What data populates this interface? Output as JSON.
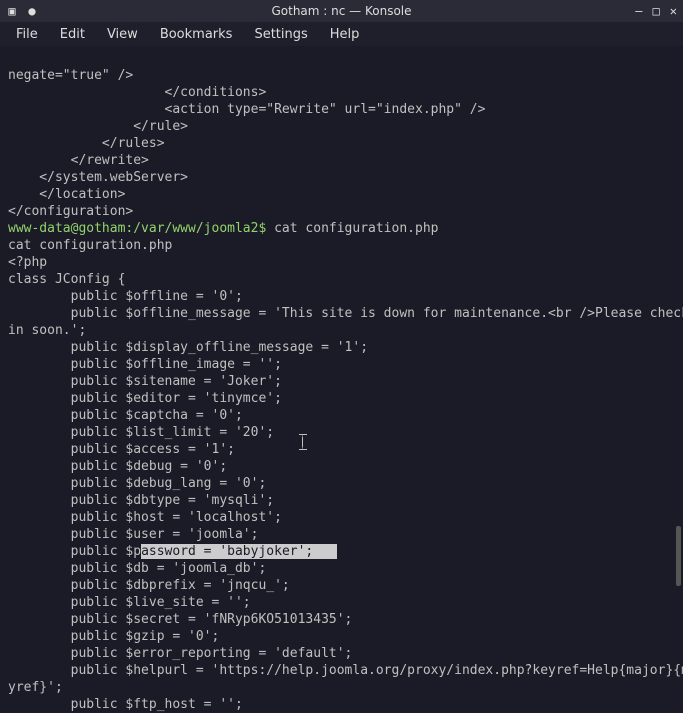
{
  "window": {
    "title": "Gotham : nc — Konsole"
  },
  "menu": {
    "file": "File",
    "edit": "Edit",
    "view": "View",
    "bookmarks": "Bookmarks",
    "settings": "Settings",
    "help": "Help"
  },
  "terminal": {
    "lines": {
      "l0": "negate=\"true\" />",
      "l1": "                    </conditions>",
      "l2": "                    <action type=\"Rewrite\" url=\"index.php\" />",
      "l3": "                </rule>",
      "l4": "            </rules>",
      "l5": "        </rewrite>",
      "l6": "    </system.webServer>",
      "l7": "    </location>",
      "l8": "</configuration>",
      "prompt": "www-data@gotham:/var/www/joomla2$ ",
      "cmd": "cat configuration.php",
      "l10": "cat configuration.php",
      "l11": "<?php",
      "l12": "class JConfig {",
      "i0": "        public $offline = '0';",
      "i1": "        public $offline_message = 'This site is down for maintenance.<br />Please check back aga",
      "i1b": "in soon.';",
      "i2": "        public $display_offline_message = '1';",
      "i3": "        public $offline_image = '';",
      "i4": "        public $sitename = 'Joker';",
      "i5": "        public $editor = 'tinymce';",
      "i6": "        public $captcha = '0';",
      "i7": "        public $list_limit = '20';",
      "i8": "        public $access = '1';",
      "i9": "        public $debug = '0';",
      "i10": "        public $debug_lang = '0';",
      "i11": "        public $dbtype = 'mysqli';",
      "i12": "        public $host = 'localhost';",
      "i13": "        public $user = 'joomla';",
      "pw_pre": "        public $p",
      "pw_sel": "assword = 'babyjoker';",
      "pw_post": "   ",
      "i15": "        public $db = 'joomla_db';",
      "i16": "        public $dbprefix = 'jnqcu_';",
      "i17": "        public $live_site = '';",
      "i18": "        public $secret = 'fNRyp6KO51013435';",
      "i19": "        public $gzip = '0';",
      "i20": "        public $error_reporting = 'default';",
      "i21": "        public $helpurl = 'https://help.joomla.org/proxy/index.php?keyref=Help{major}{minor}:{ke",
      "i21b": "yref}';",
      "i22": "        public $ftp_host = '';"
    }
  }
}
